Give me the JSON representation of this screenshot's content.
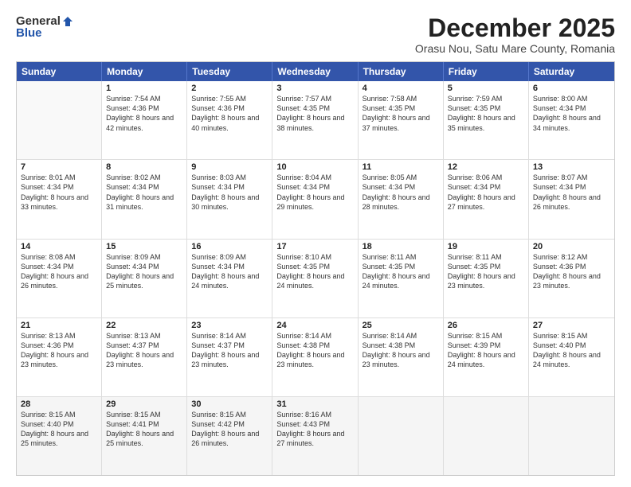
{
  "logo": {
    "general": "General",
    "blue": "Blue"
  },
  "title": "December 2025",
  "subtitle": "Orasu Nou, Satu Mare County, Romania",
  "days": [
    "Sunday",
    "Monday",
    "Tuesday",
    "Wednesday",
    "Thursday",
    "Friday",
    "Saturday"
  ],
  "weeks": [
    [
      {
        "num": "",
        "sunrise": "",
        "sunset": "",
        "daylight": ""
      },
      {
        "num": "1",
        "sunrise": "Sunrise: 7:54 AM",
        "sunset": "Sunset: 4:36 PM",
        "daylight": "Daylight: 8 hours and 42 minutes."
      },
      {
        "num": "2",
        "sunrise": "Sunrise: 7:55 AM",
        "sunset": "Sunset: 4:36 PM",
        "daylight": "Daylight: 8 hours and 40 minutes."
      },
      {
        "num": "3",
        "sunrise": "Sunrise: 7:57 AM",
        "sunset": "Sunset: 4:35 PM",
        "daylight": "Daylight: 8 hours and 38 minutes."
      },
      {
        "num": "4",
        "sunrise": "Sunrise: 7:58 AM",
        "sunset": "Sunset: 4:35 PM",
        "daylight": "Daylight: 8 hours and 37 minutes."
      },
      {
        "num": "5",
        "sunrise": "Sunrise: 7:59 AM",
        "sunset": "Sunset: 4:35 PM",
        "daylight": "Daylight: 8 hours and 35 minutes."
      },
      {
        "num": "6",
        "sunrise": "Sunrise: 8:00 AM",
        "sunset": "Sunset: 4:34 PM",
        "daylight": "Daylight: 8 hours and 34 minutes."
      }
    ],
    [
      {
        "num": "7",
        "sunrise": "Sunrise: 8:01 AM",
        "sunset": "Sunset: 4:34 PM",
        "daylight": "Daylight: 8 hours and 33 minutes."
      },
      {
        "num": "8",
        "sunrise": "Sunrise: 8:02 AM",
        "sunset": "Sunset: 4:34 PM",
        "daylight": "Daylight: 8 hours and 31 minutes."
      },
      {
        "num": "9",
        "sunrise": "Sunrise: 8:03 AM",
        "sunset": "Sunset: 4:34 PM",
        "daylight": "Daylight: 8 hours and 30 minutes."
      },
      {
        "num": "10",
        "sunrise": "Sunrise: 8:04 AM",
        "sunset": "Sunset: 4:34 PM",
        "daylight": "Daylight: 8 hours and 29 minutes."
      },
      {
        "num": "11",
        "sunrise": "Sunrise: 8:05 AM",
        "sunset": "Sunset: 4:34 PM",
        "daylight": "Daylight: 8 hours and 28 minutes."
      },
      {
        "num": "12",
        "sunrise": "Sunrise: 8:06 AM",
        "sunset": "Sunset: 4:34 PM",
        "daylight": "Daylight: 8 hours and 27 minutes."
      },
      {
        "num": "13",
        "sunrise": "Sunrise: 8:07 AM",
        "sunset": "Sunset: 4:34 PM",
        "daylight": "Daylight: 8 hours and 26 minutes."
      }
    ],
    [
      {
        "num": "14",
        "sunrise": "Sunrise: 8:08 AM",
        "sunset": "Sunset: 4:34 PM",
        "daylight": "Daylight: 8 hours and 26 minutes."
      },
      {
        "num": "15",
        "sunrise": "Sunrise: 8:09 AM",
        "sunset": "Sunset: 4:34 PM",
        "daylight": "Daylight: 8 hours and 25 minutes."
      },
      {
        "num": "16",
        "sunrise": "Sunrise: 8:09 AM",
        "sunset": "Sunset: 4:34 PM",
        "daylight": "Daylight: 8 hours and 24 minutes."
      },
      {
        "num": "17",
        "sunrise": "Sunrise: 8:10 AM",
        "sunset": "Sunset: 4:35 PM",
        "daylight": "Daylight: 8 hours and 24 minutes."
      },
      {
        "num": "18",
        "sunrise": "Sunrise: 8:11 AM",
        "sunset": "Sunset: 4:35 PM",
        "daylight": "Daylight: 8 hours and 24 minutes."
      },
      {
        "num": "19",
        "sunrise": "Sunrise: 8:11 AM",
        "sunset": "Sunset: 4:35 PM",
        "daylight": "Daylight: 8 hours and 23 minutes."
      },
      {
        "num": "20",
        "sunrise": "Sunrise: 8:12 AM",
        "sunset": "Sunset: 4:36 PM",
        "daylight": "Daylight: 8 hours and 23 minutes."
      }
    ],
    [
      {
        "num": "21",
        "sunrise": "Sunrise: 8:13 AM",
        "sunset": "Sunset: 4:36 PM",
        "daylight": "Daylight: 8 hours and 23 minutes."
      },
      {
        "num": "22",
        "sunrise": "Sunrise: 8:13 AM",
        "sunset": "Sunset: 4:37 PM",
        "daylight": "Daylight: 8 hours and 23 minutes."
      },
      {
        "num": "23",
        "sunrise": "Sunrise: 8:14 AM",
        "sunset": "Sunset: 4:37 PM",
        "daylight": "Daylight: 8 hours and 23 minutes."
      },
      {
        "num": "24",
        "sunrise": "Sunrise: 8:14 AM",
        "sunset": "Sunset: 4:38 PM",
        "daylight": "Daylight: 8 hours and 23 minutes."
      },
      {
        "num": "25",
        "sunrise": "Sunrise: 8:14 AM",
        "sunset": "Sunset: 4:38 PM",
        "daylight": "Daylight: 8 hours and 23 minutes."
      },
      {
        "num": "26",
        "sunrise": "Sunrise: 8:15 AM",
        "sunset": "Sunset: 4:39 PM",
        "daylight": "Daylight: 8 hours and 24 minutes."
      },
      {
        "num": "27",
        "sunrise": "Sunrise: 8:15 AM",
        "sunset": "Sunset: 4:40 PM",
        "daylight": "Daylight: 8 hours and 24 minutes."
      }
    ],
    [
      {
        "num": "28",
        "sunrise": "Sunrise: 8:15 AM",
        "sunset": "Sunset: 4:40 PM",
        "daylight": "Daylight: 8 hours and 25 minutes."
      },
      {
        "num": "29",
        "sunrise": "Sunrise: 8:15 AM",
        "sunset": "Sunset: 4:41 PM",
        "daylight": "Daylight: 8 hours and 25 minutes."
      },
      {
        "num": "30",
        "sunrise": "Sunrise: 8:15 AM",
        "sunset": "Sunset: 4:42 PM",
        "daylight": "Daylight: 8 hours and 26 minutes."
      },
      {
        "num": "31",
        "sunrise": "Sunrise: 8:16 AM",
        "sunset": "Sunset: 4:43 PM",
        "daylight": "Daylight: 8 hours and 27 minutes."
      },
      {
        "num": "",
        "sunrise": "",
        "sunset": "",
        "daylight": ""
      },
      {
        "num": "",
        "sunrise": "",
        "sunset": "",
        "daylight": ""
      },
      {
        "num": "",
        "sunrise": "",
        "sunset": "",
        "daylight": ""
      }
    ]
  ]
}
